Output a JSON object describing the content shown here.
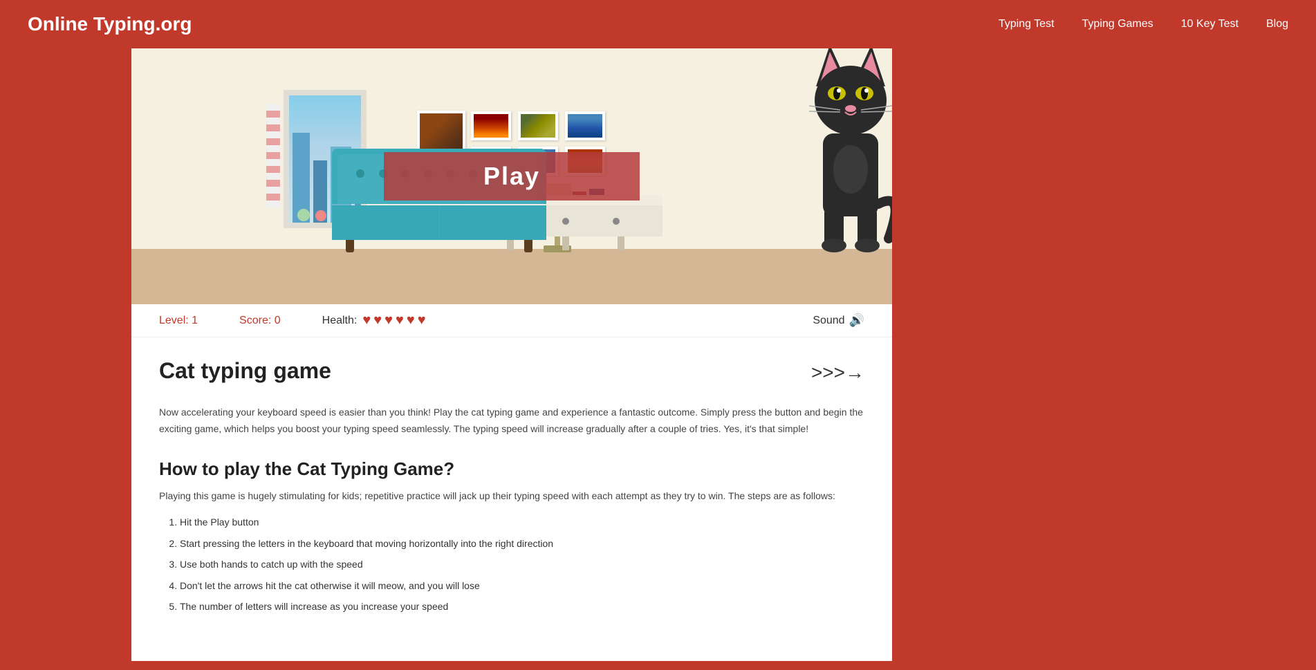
{
  "header": {
    "logo": "Online Typing.org",
    "nav": [
      {
        "label": "Typing Test",
        "href": "#"
      },
      {
        "label": "Typing Games",
        "href": "#"
      },
      {
        "label": "10 Key Test",
        "href": "#"
      },
      {
        "label": "Blog",
        "href": "#"
      }
    ]
  },
  "game": {
    "play_button_label": "Play",
    "level_label": "Level: 1",
    "score_label": "Score: 0",
    "health_label": "Health:",
    "heart_count": 6,
    "sound_label": "Sound"
  },
  "content": {
    "title": "Cat typing game",
    "next_arrow": ">>>→",
    "intro": "Now accelerating your keyboard speed is easier than you think! Play the cat typing game and experience a fantastic outcome. Simply press the button and begin the exciting game, which helps you boost your typing speed seamlessly. The typing speed will increase gradually after a couple of tries. Yes, it's that simple!",
    "how_to_title": "How to play the Cat Typing Game?",
    "how_to_intro": "Playing this game is hugely stimulating for kids; repetitive practice will jack up their typing speed with each attempt as they try to win. The steps are as follows:",
    "steps": [
      "Hit the Play button",
      "Start pressing the letters in the keyboard that moving horizontally into the right direction",
      "Use both hands to catch up with the speed",
      "Don't let the arrows hit the cat otherwise it will meow, and you will lose",
      "The number of letters will increase as you increase your speed"
    ]
  }
}
